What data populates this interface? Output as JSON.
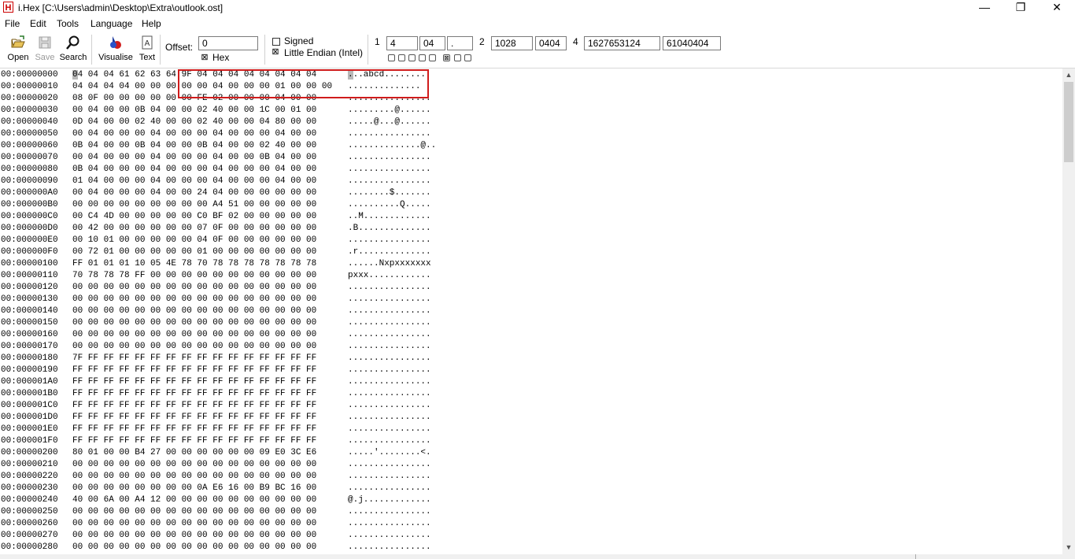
{
  "window": {
    "app_icon_letter": "H",
    "title": "i.Hex [C:\\Users\\admin\\Desktop\\Extra\\outlook.ost]",
    "minimize_glyph": "—",
    "restore_glyph": "❐",
    "close_glyph": "✕"
  },
  "menu": {
    "file": "File",
    "edit": "Edit",
    "tools": "Tools",
    "language": "Language",
    "help": "Help"
  },
  "toolbar": {
    "open": "Open",
    "save": "Save",
    "search": "Search",
    "visualise": "Visualise",
    "text": "Text",
    "offset_label": "Offset:",
    "offset_value": "0",
    "hex_check": "⊠",
    "hex_label": "Hex",
    "signed_check": "",
    "signed_label": "Signed",
    "little_endian_check": "⊠",
    "little_endian_label": "Little Endian (Intel)",
    "w1_label": "1",
    "w1_dec": "4",
    "w1_hex": "04",
    "w1_char": ".",
    "w2_label": "2",
    "w2_dec": "1028",
    "w2_hex": "0404",
    "w4_label": "4",
    "w4_dec": "1627653124",
    "w4_hex": "61040404",
    "bits": [
      "",
      "",
      "",
      "",
      "",
      "⊠",
      "",
      ""
    ]
  },
  "rows": [
    {
      "addr": "00:00000000",
      "hex": "04 04 04 61 62 63 64 9F 04 04 04 04 04 04 04 04",
      "ascii": "...abcd........."
    },
    {
      "addr": "00:00000010",
      "hex": "04 04 04 04 00 00 00 00 00 04 00 00 00 01 00 00 00",
      "ascii": ".............."
    },
    {
      "addr": "00:00000020",
      "hex": "08 0F 00 00 00 00 00 00 FE 02 00 00 00 04 00 00",
      "ascii": "................"
    },
    {
      "addr": "00:00000030",
      "hex": "00 04 00 00 0B 04 00 00 02 40 00 00 1C 00 01 00",
      "ascii": ".........@......"
    },
    {
      "addr": "00:00000040",
      "hex": "0D 04 00 00 02 40 00 00 02 40 00 00 04 80 00 00",
      "ascii": ".....@...@......"
    },
    {
      "addr": "00:00000050",
      "hex": "00 04 00 00 00 04 00 00 00 04 00 00 00 04 00 00",
      "ascii": "................"
    },
    {
      "addr": "00:00000060",
      "hex": "0B 04 00 00 0B 04 00 00 0B 04 00 00 02 40 00 00",
      "ascii": "..............@.."
    },
    {
      "addr": "00:00000070",
      "hex": "00 04 00 00 00 04 00 00 00 04 00 00 0B 04 00 00",
      "ascii": "................"
    },
    {
      "addr": "00:00000080",
      "hex": "0B 04 00 00 00 04 00 00 00 04 00 00 00 04 00 00",
      "ascii": "................"
    },
    {
      "addr": "00:00000090",
      "hex": "01 04 00 00 00 04 00 00 00 04 00 00 00 04 00 00",
      "ascii": "................"
    },
    {
      "addr": "00:000000A0",
      "hex": "00 04 00 00 00 04 00 00 24 04 00 00 00 00 00 00",
      "ascii": "........$......."
    },
    {
      "addr": "00:000000B0",
      "hex": "00 00 00 00 00 00 00 00 00 A4 51 00 00 00 00 00",
      "ascii": "..........Q....."
    },
    {
      "addr": "00:000000C0",
      "hex": "00 C4 4D 00 00 00 00 00 C0 BF 02 00 00 00 00 00",
      "ascii": "..M............."
    },
    {
      "addr": "00:000000D0",
      "hex": "00 42 00 00 00 00 00 00 07 0F 00 00 00 00 00 00",
      "ascii": ".B.............."
    },
    {
      "addr": "00:000000E0",
      "hex": "00 10 01 00 00 00 00 00 04 0F 00 00 00 00 00 00",
      "ascii": "................"
    },
    {
      "addr": "00:000000F0",
      "hex": "00 72 01 00 00 00 00 00 01 00 00 00 00 00 00 00",
      "ascii": ".r.............."
    },
    {
      "addr": "00:00000100",
      "hex": "FF 01 01 01 10 05 4E 78 70 78 78 78 78 78 78 78",
      "ascii": "......Nxpxxxxxxx"
    },
    {
      "addr": "00:00000110",
      "hex": "70 78 78 78 FF 00 00 00 00 00 00 00 00 00 00 00",
      "ascii": "pxxx............"
    },
    {
      "addr": "00:00000120",
      "hex": "00 00 00 00 00 00 00 00 00 00 00 00 00 00 00 00",
      "ascii": "................"
    },
    {
      "addr": "00:00000130",
      "hex": "00 00 00 00 00 00 00 00 00 00 00 00 00 00 00 00",
      "ascii": "................"
    },
    {
      "addr": "00:00000140",
      "hex": "00 00 00 00 00 00 00 00 00 00 00 00 00 00 00 00",
      "ascii": "................"
    },
    {
      "addr": "00:00000150",
      "hex": "00 00 00 00 00 00 00 00 00 00 00 00 00 00 00 00",
      "ascii": "................"
    },
    {
      "addr": "00:00000160",
      "hex": "00 00 00 00 00 00 00 00 00 00 00 00 00 00 00 00",
      "ascii": "................"
    },
    {
      "addr": "00:00000170",
      "hex": "00 00 00 00 00 00 00 00 00 00 00 00 00 00 00 00",
      "ascii": "................"
    },
    {
      "addr": "00:00000180",
      "hex": "7F FF FF FF FF FF FF FF FF FF FF FF FF FF FF FF",
      "ascii": "................"
    },
    {
      "addr": "00:00000190",
      "hex": "FF FF FF FF FF FF FF FF FF FF FF FF FF FF FF FF",
      "ascii": "................"
    },
    {
      "addr": "00:000001A0",
      "hex": "FF FF FF FF FF FF FF FF FF FF FF FF FF FF FF FF",
      "ascii": "................"
    },
    {
      "addr": "00:000001B0",
      "hex": "FF FF FF FF FF FF FF FF FF FF FF FF FF FF FF FF",
      "ascii": "................"
    },
    {
      "addr": "00:000001C0",
      "hex": "FF FF FF FF FF FF FF FF FF FF FF FF FF FF FF FF",
      "ascii": "................"
    },
    {
      "addr": "00:000001D0",
      "hex": "FF FF FF FF FF FF FF FF FF FF FF FF FF FF FF FF",
      "ascii": "................"
    },
    {
      "addr": "00:000001E0",
      "hex": "FF FF FF FF FF FF FF FF FF FF FF FF FF FF FF FF",
      "ascii": "................"
    },
    {
      "addr": "00:000001F0",
      "hex": "FF FF FF FF FF FF FF FF FF FF FF FF FF FF FF FF",
      "ascii": "................"
    },
    {
      "addr": "00:00000200",
      "hex": "80 01 00 00 B4 27 00 00 00 00 00 00 09 E0 3C E6",
      "ascii": ".....'........<."
    },
    {
      "addr": "00:00000210",
      "hex": "00 00 00 00 00 00 00 00 00 00 00 00 00 00 00 00",
      "ascii": "................"
    },
    {
      "addr": "00:00000220",
      "hex": "00 00 00 00 00 00 00 00 00 00 00 00 00 00 00 00",
      "ascii": "................"
    },
    {
      "addr": "00:00000230",
      "hex": "00 00 00 00 00 00 00 00 0A E6 16 00 B9 BC 16 00",
      "ascii": "................"
    },
    {
      "addr": "00:00000240",
      "hex": "40 00 6A 00 A4 12 00 00 00 00 00 00 00 00 00 00",
      "ascii": "@.j............."
    },
    {
      "addr": "00:00000250",
      "hex": "00 00 00 00 00 00 00 00 00 00 00 00 00 00 00 00",
      "ascii": "................"
    },
    {
      "addr": "00:00000260",
      "hex": "00 00 00 00 00 00 00 00 00 00 00 00 00 00 00 00",
      "ascii": "................"
    },
    {
      "addr": "00:00000270",
      "hex": "00 00 00 00 00 00 00 00 00 00 00 00 00 00 00 00",
      "ascii": "................"
    },
    {
      "addr": "00:00000280",
      "hex": "00 00 00 00 00 00 00 00 00 00 00 00 00 00 00 00",
      "ascii": "................"
    }
  ],
  "colors": {
    "selection_border": "#d01c1c",
    "app_icon": "#cc0000"
  }
}
